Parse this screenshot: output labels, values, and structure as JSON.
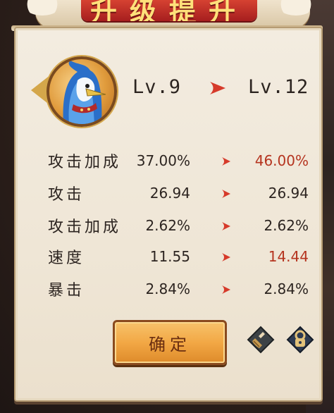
{
  "header": {
    "title": "升级提升"
  },
  "level": {
    "from": "Lv.9",
    "to": "Lv.12"
  },
  "stats": [
    {
      "name": "攻击加成",
      "old": "37.00%",
      "new": "46.00%",
      "increased": true
    },
    {
      "name": "攻击",
      "old": "26.94",
      "new": "26.94",
      "increased": false
    },
    {
      "name": "攻击加成",
      "old": "2.62%",
      "new": "2.62%",
      "increased": false
    },
    {
      "name": "速度",
      "old": "11.55",
      "new": "14.44",
      "increased": true
    },
    {
      "name": "暴击",
      "old": "2.84%",
      "new": "2.84%",
      "increased": false
    }
  ],
  "confirm_label": "确定",
  "colors": {
    "increase": "#b5341f",
    "arrow": "#d63a2a",
    "text": "#2c2420"
  },
  "icons": {
    "broom": "broom-icon",
    "lock": "lock-icon",
    "avatar": "bird-avatar"
  }
}
